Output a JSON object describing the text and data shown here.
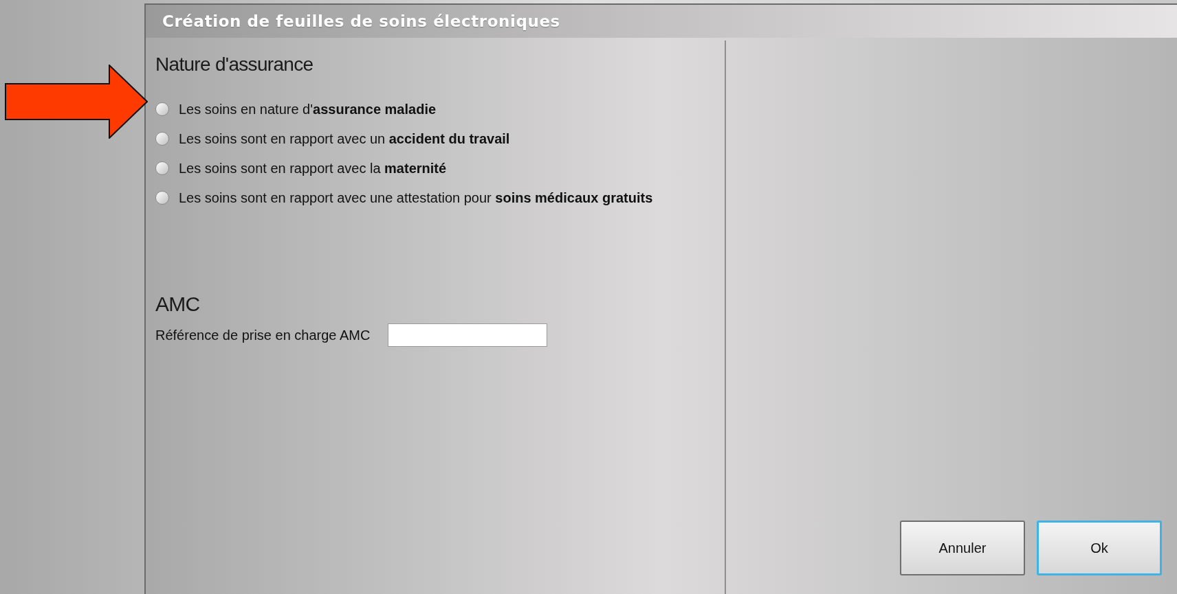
{
  "window": {
    "title": "Création de feuilles de soins électroniques"
  },
  "insurance": {
    "heading": "Nature d'assurance",
    "options": [
      {
        "label": "Les soins en nature d'**assurance maladie**",
        "selected": false
      },
      {
        "label": "Les soins sont en rapport avec un **accident du travail**",
        "selected": false
      },
      {
        "label": "Les soins sont en rapport avec la **maternité**",
        "selected": false
      },
      {
        "label": "Les soins sont en rapport avec une attestation pour **soins médicaux gratuits**",
        "selected": false
      }
    ]
  },
  "amc": {
    "heading": "AMC",
    "field_label": "Référence de prise en charge AMC"
  },
  "buttons": [
    {
      "label": "Annuler",
      "focused": false
    },
    {
      "label": "Ok",
      "focused": true
    }
  ]
}
